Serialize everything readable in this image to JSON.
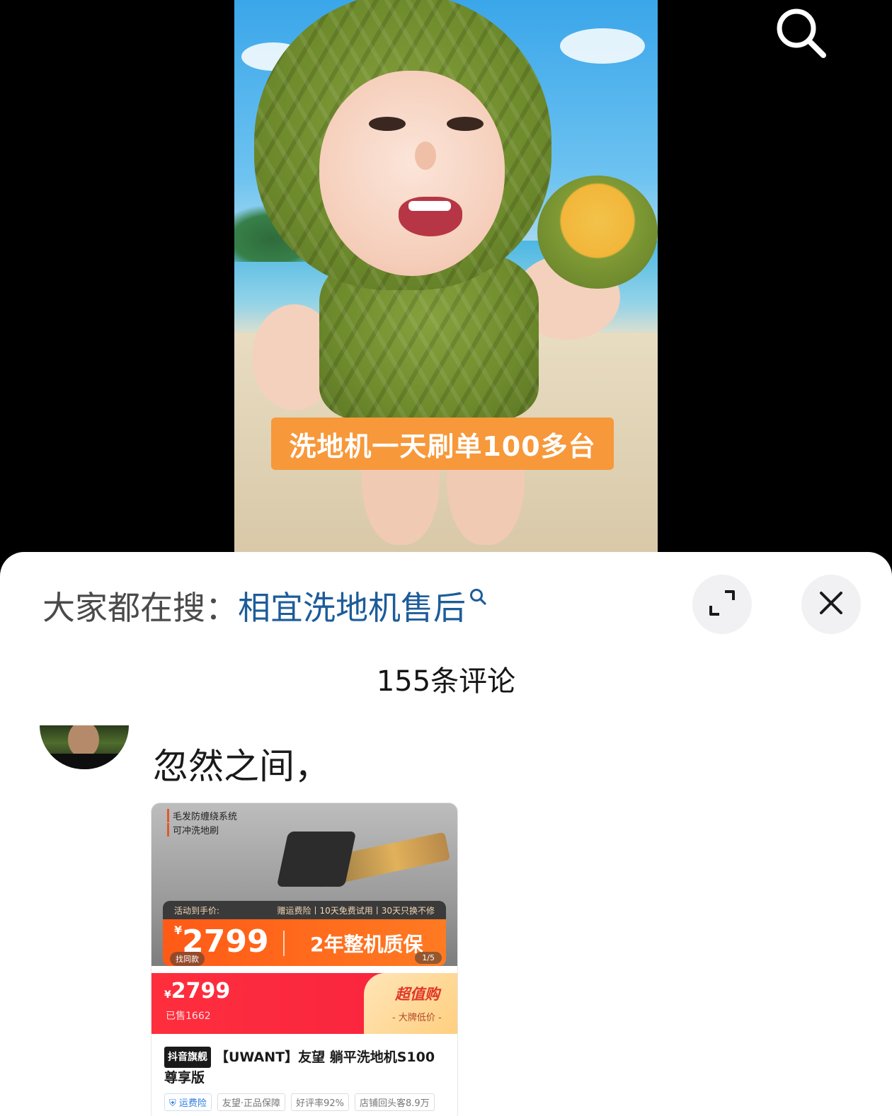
{
  "video": {
    "caption": "洗地机一天刷单100多台"
  },
  "sheet": {
    "suggest_prefix": "大家都在搜：",
    "suggest_query": "相宜洗地机售后",
    "comment_count": "155条评论"
  },
  "comment": {
    "text": "忽然之间，"
  },
  "product": {
    "features": [
      "毛发防缠绕系统",
      "可冲洗地刷"
    ],
    "promo_left": "活动到手价:",
    "promo_right": "赠运费险丨10天免费试用丨30天只换不修",
    "promo_currency": "¥",
    "promo_price": "2799",
    "promo_warranty": "2年整机质保",
    "find_same": "找同款",
    "page_indicator": "1/5",
    "band_currency": "¥",
    "band_price": "2799",
    "sold": "已售1662",
    "value_title": "超值购",
    "value_sub": "- 大牌低价 -",
    "store_badge": "抖音旗舰",
    "title": "【UWANT】友望 躺平洗地机S100尊享版",
    "tags": [
      "运费险",
      "友望·正品保障",
      "好评率92%",
      "店铺回头客8.9万"
    ]
  }
}
